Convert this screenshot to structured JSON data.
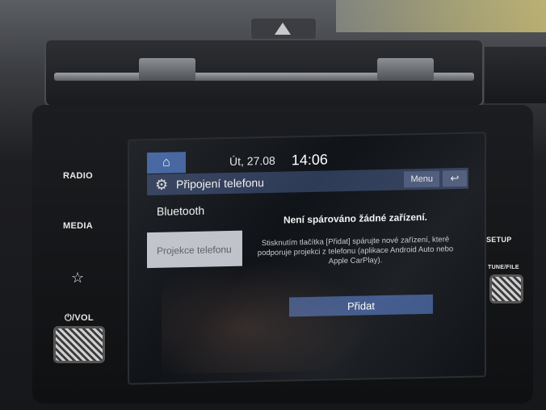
{
  "dashboard": {
    "buttons": [
      {
        "id": "radio",
        "label": "RADIO"
      },
      {
        "id": "media",
        "label": "MEDIA"
      },
      {
        "id": "favorite",
        "label": "☆"
      },
      {
        "id": "power_vol",
        "label": "⏻/VOL"
      },
      {
        "id": "setup",
        "label": "SETUP"
      },
      {
        "id": "tune_file",
        "label": "TUNE/FILE"
      }
    ]
  },
  "screen": {
    "status_bar": {
      "date": "Út, 27.08",
      "time": "14:06",
      "home_icon": "home-icon"
    },
    "title_bar": {
      "title": "Připojení telefonu",
      "menu_label": "Menu",
      "back_icon": "back-arrow-icon",
      "settings_icon": "gear-icon"
    },
    "sidebar": {
      "items": [
        {
          "label": "Bluetooth"
        },
        {
          "label": "Projekce telefonu"
        }
      ]
    },
    "main": {
      "headline": "Není spárováno žádné zařízení.",
      "description": "Stisknutím tlačítka [Přidat] spárujte nové zařízení, které podporuje projekci z telefonu (aplikace Android Auto nebo Apple CarPlay).",
      "add_button_label": "Přidat"
    }
  },
  "colors": {
    "accent": "#3d5f9c",
    "title_bar": "#2e3b57",
    "selected_item": "#bfc3c9"
  }
}
